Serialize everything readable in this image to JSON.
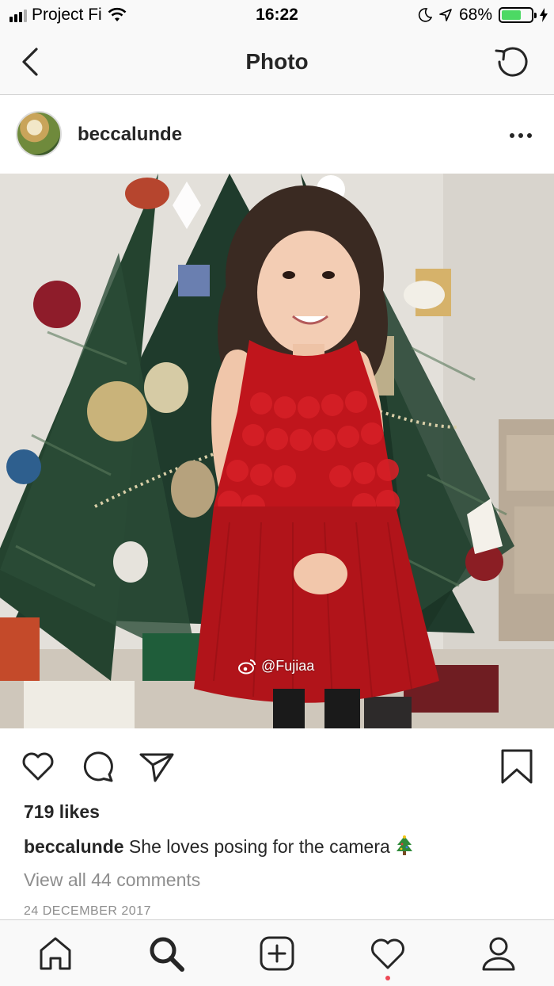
{
  "status_bar": {
    "carrier": "Project Fi",
    "time": "16:22",
    "battery_percent": "68%",
    "battery_level": 0.68,
    "battery_color": "#4cd964",
    "icons": [
      "signal-icon",
      "wifi-icon",
      "moon-icon",
      "location-arrow-icon",
      "battery-icon",
      "charging-bolt-icon"
    ]
  },
  "nav": {
    "title": "Photo",
    "back_icon": "chevron-left-icon",
    "refresh_icon": "refresh-icon"
  },
  "post": {
    "username": "beccalunde",
    "more_icon": "more-dots-icon",
    "watermark": "@Fujiaa",
    "watermark_icon": "weibo-icon",
    "likes": "719 likes",
    "caption_user": "beccalunde",
    "caption_text": " She loves posing for the camera",
    "caption_emoji_icon": "christmas-tree-emoji",
    "comments_link": "View all 44 comments",
    "date": "24 DECEMBER 2017",
    "action_icons": [
      "heart-icon",
      "comment-icon",
      "share-icon",
      "bookmark-icon"
    ]
  },
  "tabbar": {
    "tabs": [
      "home-icon",
      "search-icon",
      "add-post-icon",
      "activity-heart-icon",
      "profile-icon"
    ],
    "notification_dot_color": "#ed4956"
  }
}
